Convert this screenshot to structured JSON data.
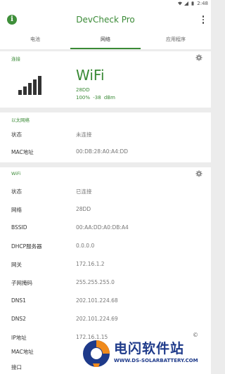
{
  "status_bar": {
    "time": "2:48"
  },
  "app": {
    "title": "DevCheck Pro"
  },
  "tabs": [
    {
      "label": "电池",
      "active": false
    },
    {
      "label": "网络",
      "active": true
    },
    {
      "label": "应用程序",
      "active": false
    }
  ],
  "connection": {
    "header": "连接",
    "signal_bars_active": 5,
    "title": "WiFi",
    "ssid": "28DD",
    "strength": "100%",
    "dbm": "-38 dBm"
  },
  "ethernet": {
    "header": "以太网络",
    "rows": [
      {
        "label": "状态",
        "value": "未连接"
      },
      {
        "label": "MAC地址",
        "value": "00:DB:28:A0:A4:DD"
      }
    ]
  },
  "wifi": {
    "header": "WiFi",
    "rows": [
      {
        "label": "状态",
        "value": "已连接"
      },
      {
        "label": "网络",
        "value": "28DD"
      },
      {
        "label": "BSSID",
        "value": "00:AA:DD:A0:DB:A4"
      },
      {
        "label": "DHCP服务器",
        "value": "0.0.0.0"
      },
      {
        "label": "网关",
        "value": "172.16.1.2"
      },
      {
        "label": "子网掩码",
        "value": "255.255.255.0"
      },
      {
        "label": "DNS1",
        "value": "202.101.224.68"
      },
      {
        "label": "DNS2",
        "value": "202.101.224.69"
      },
      {
        "label": "IP地址",
        "value": "172.16.1.15"
      },
      {
        "label": "MAC地址",
        "value": ""
      },
      {
        "label": "接口",
        "value": ""
      }
    ]
  },
  "watermark": {
    "title": "电闪软件站",
    "url": "WWW.DS-SOLARBATTERY.COM"
  },
  "colors": {
    "accent": "#3a8a36",
    "background": "#ececec",
    "watermark": "#1e3a8a"
  }
}
